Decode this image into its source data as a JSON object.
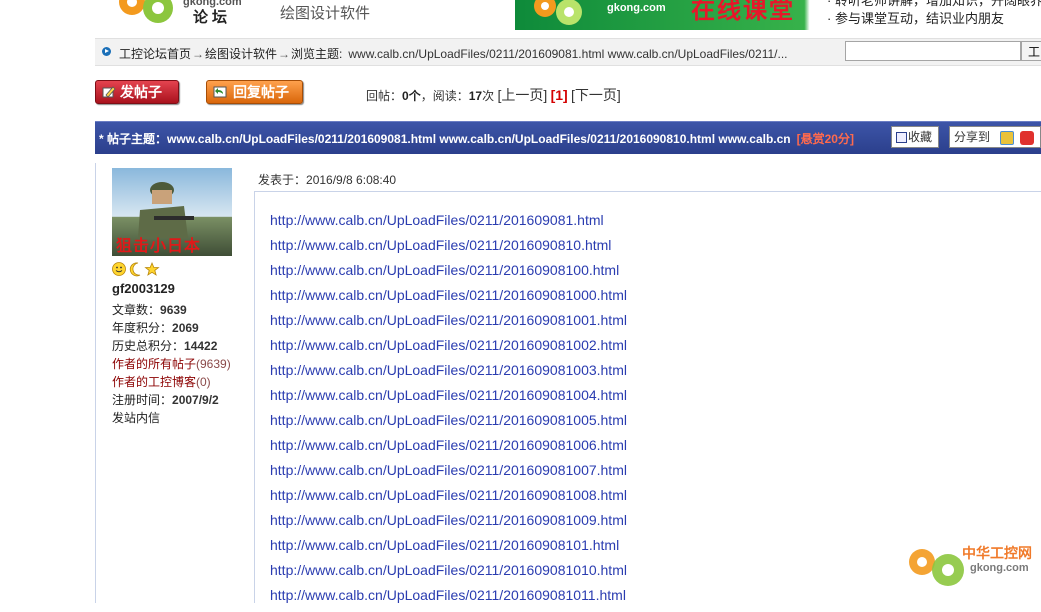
{
  "header": {
    "logo_site": "gkong.com",
    "logo_forum": "论坛",
    "category_title": "绘图设计软件",
    "banner": {
      "site": "gkong.com",
      "title": "在线课堂",
      "line1": "· 聆听老师讲解，增加知识，开阔眼界",
      "line2": "· 参与课堂互动，结识业内朋友"
    }
  },
  "breadcrumb": {
    "home": "工控论坛首页",
    "section": "绘图设计软件",
    "browse_label": "浏览主题:",
    "topic_url": "www.calb.cn/UpLoadFiles/0211/201609081.html www.calb.cn/UpLoadFiles/0211/...",
    "arrow": "→"
  },
  "search": {
    "value": "",
    "button_label": "工"
  },
  "actions": {
    "post_label": "发帖子",
    "reply_label": "回复帖子"
  },
  "stats": {
    "replies_label": "回帖：",
    "replies": "0个",
    "reads_label": "，阅读：",
    "reads": "17",
    "reads_unit": "次",
    "prev": "[上一页]",
    "current": "[1]",
    "next": "[下一页]"
  },
  "topic": {
    "prefix": "* 帖子主题：",
    "title": "www.calb.cn/UpLoadFiles/0211/201609081.html www.calb.cn/UpLoadFiles/0211/2016090810.html www.calb.cn",
    "bounty": "[悬赏20分]",
    "fav_label": "收藏",
    "share_label": "分享到"
  },
  "author": {
    "avatar_caption": "狙击小日本",
    "name": "gf2003129",
    "posts_label": "文章数：",
    "posts": "9639",
    "year_label": "年度积分：",
    "year_points": "2069",
    "history_label": "历史总积分：",
    "history_points": "14422",
    "all_posts_link": "作者的所有帖子",
    "all_posts_count": "(9639)",
    "blog_link": "作者的工控博客",
    "blog_count": "(0)",
    "reg_label": "注册时间：",
    "reg_date": "2007/9/2",
    "pm_link": "发站内信"
  },
  "post": {
    "date_label": "发表于：",
    "date": "2016/9/8 6:08:40",
    "links": [
      "http://www.calb.cn/UpLoadFiles/0211/201609081.html",
      "http://www.calb.cn/UpLoadFiles/0211/2016090810.html",
      "http://www.calb.cn/UpLoadFiles/0211/20160908100.html",
      "http://www.calb.cn/UpLoadFiles/0211/201609081000.html",
      "http://www.calb.cn/UpLoadFiles/0211/201609081001.html",
      "http://www.calb.cn/UpLoadFiles/0211/201609081002.html",
      "http://www.calb.cn/UpLoadFiles/0211/201609081003.html",
      "http://www.calb.cn/UpLoadFiles/0211/201609081004.html",
      "http://www.calb.cn/UpLoadFiles/0211/201609081005.html",
      "http://www.calb.cn/UpLoadFiles/0211/201609081006.html",
      "http://www.calb.cn/UpLoadFiles/0211/201609081007.html",
      "http://www.calb.cn/UpLoadFiles/0211/201609081008.html",
      "http://www.calb.cn/UpLoadFiles/0211/201609081009.html",
      "http://www.calb.cn/UpLoadFiles/0211/20160908101.html",
      "http://www.calb.cn/UpLoadFiles/0211/201609081010.html",
      "http://www.calb.cn/UpLoadFiles/0211/201609081011.html"
    ]
  },
  "watermark": {
    "title": "中华工控网",
    "site": "gkong.com"
  },
  "colors": {
    "topic_bar": "#2b3f8c",
    "link": "#2a3cb0",
    "post_button": "#c41e2a",
    "reply_button": "#f0801f",
    "bounty": "#ff6a4d"
  }
}
